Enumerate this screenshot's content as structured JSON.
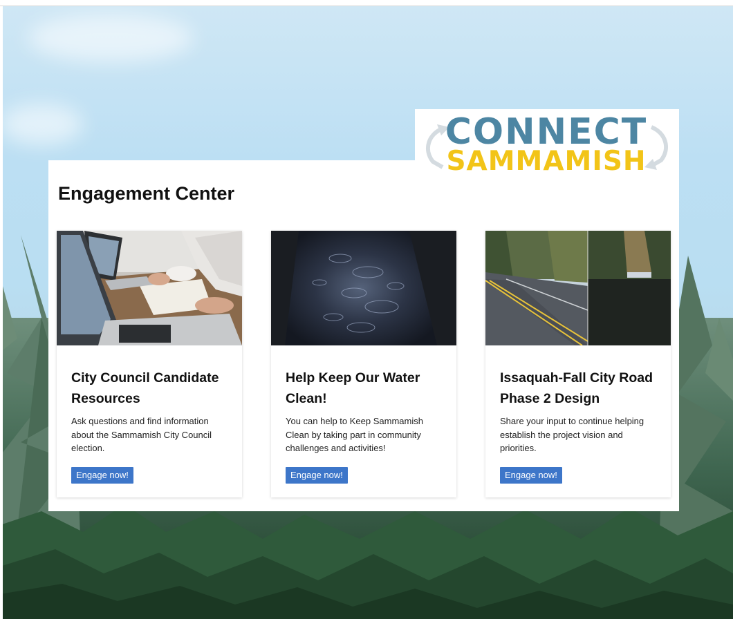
{
  "logo": {
    "line1": "CONNECT",
    "line2": "SAMMAMISH"
  },
  "main": {
    "title": "Engagement Center",
    "cards": [
      {
        "title": "City Council Candidate Resources",
        "description": "Ask questions and find information about the Sammamish City Council election.",
        "button_label": "Engage now!",
        "image": "laptop-meeting-photo"
      },
      {
        "title": "Help Keep Our Water Clean!",
        "description": "You can help to Keep Sammamish Clean by taking part in community challenges and activities!",
        "button_label": "Engage now!",
        "image": "rain-puddle-photo"
      },
      {
        "title": "Issaquah-Fall City Road Phase 2 Design",
        "description": "Share your input to continue helping establish the project vision and priorities.",
        "button_label": "Engage now!",
        "image": "road-and-pond-photo"
      }
    ]
  },
  "colors": {
    "logo_blue": "#4d86a3",
    "logo_yellow": "#f2c418",
    "button_blue": "#3d76c9"
  }
}
